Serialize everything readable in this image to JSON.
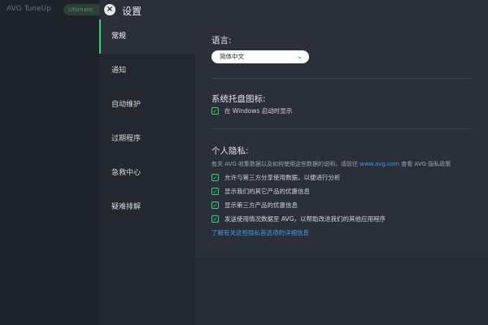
{
  "background": {
    "title": "AVG TuneUp",
    "pill": "Ultimate"
  },
  "dialog": {
    "title": "设置",
    "close_icon": "×"
  },
  "nav": {
    "items": [
      {
        "label": "常规",
        "active": true
      },
      {
        "label": "通知"
      },
      {
        "label": "自动维护"
      },
      {
        "label": "过期程序"
      },
      {
        "label": "急救中心"
      },
      {
        "label": "疑难排解"
      }
    ]
  },
  "language": {
    "title": "语言:",
    "selected": "简体中文",
    "chevron": "⌄"
  },
  "tray": {
    "title": "系统托盘图标:",
    "option": "在 Windows 启动时显示"
  },
  "privacy": {
    "title": "个人隐私:",
    "desc_before": "有关 AVG 收集数据以及如何使用这些数据的说明，请前往 ",
    "desc_link": "www.avg.com",
    "desc_after": " 查看 AVG 隐私政策",
    "options": [
      "允许与第三方分享使用数据，以便进行分析",
      "显示我们的其它产品的优惠信息",
      "显示第三方产品的优惠信息",
      "发送使用情况数据至 AVG，以帮助改进我们的其他应用程序"
    ],
    "more_link": "了解有关这些隐私首选项的详细信息"
  },
  "check_mark": "✓"
}
